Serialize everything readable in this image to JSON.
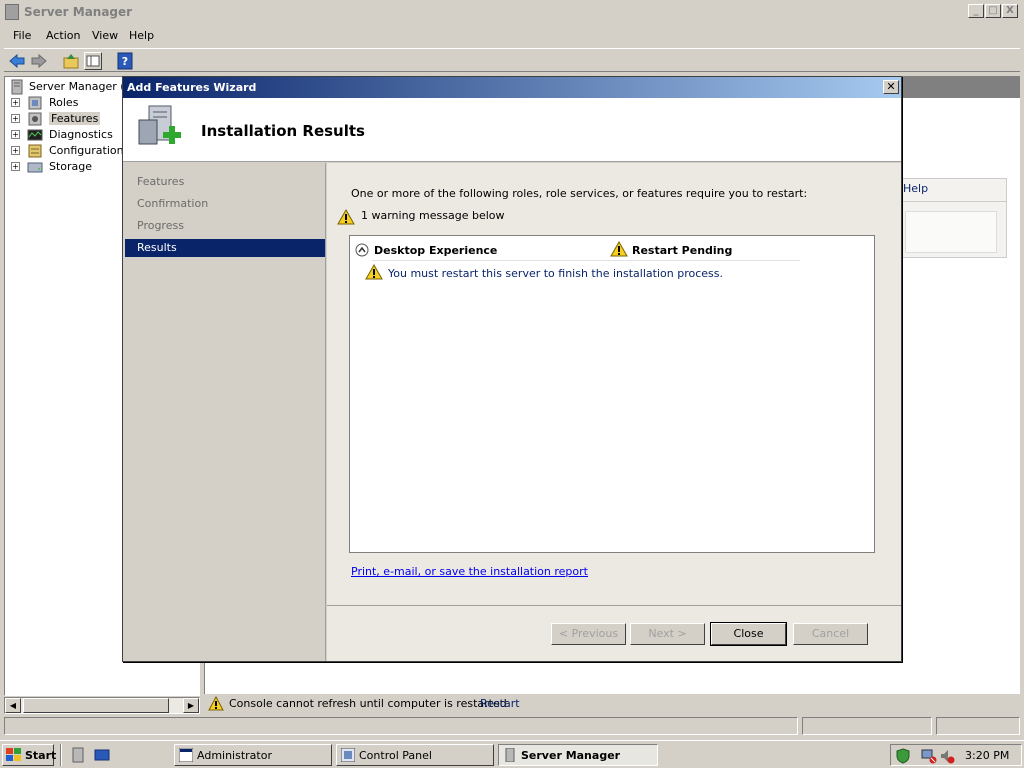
{
  "window": {
    "title": "Server Manager",
    "controls": {
      "min": "_",
      "max": "□",
      "close": "X"
    }
  },
  "menu": [
    "File",
    "Action",
    "View",
    "Help"
  ],
  "tree": [
    {
      "label": "Server Manager (W",
      "icon": "server-icon"
    },
    {
      "label": "Roles",
      "icon": "roles-icon"
    },
    {
      "label": "Features",
      "icon": "features-icon"
    },
    {
      "label": "Diagnostics",
      "icon": "diagnostics-icon"
    },
    {
      "label": "Configuration",
      "icon": "configuration-icon"
    },
    {
      "label": "Storage",
      "icon": "storage-icon"
    }
  ],
  "help_link": "Help",
  "wizard": {
    "title": "Add Features Wizard",
    "header": "Installation Results",
    "steps": [
      "Features",
      "Confirmation",
      "Progress",
      "Results"
    ],
    "message": "One or more of the following roles, role services, or features require you to restart:",
    "warning_count": "1 warning message below",
    "list": {
      "name": "Desktop Experience",
      "status": "Restart Pending",
      "detail": "You must restart this server to finish the installation process."
    },
    "report_link": "Print, e-mail, or save the installation report",
    "buttons": {
      "previous": "< Previous",
      "next": "Next >",
      "close": "Close",
      "cancel": "Cancel"
    }
  },
  "status_warning": {
    "text": "Console cannot refresh until computer is restarted",
    "link": "Restart"
  },
  "taskbar": {
    "start": "Start",
    "tasks": [
      "Administrator",
      "Control Panel",
      "Server Manager"
    ],
    "clock": "3:20 PM"
  }
}
